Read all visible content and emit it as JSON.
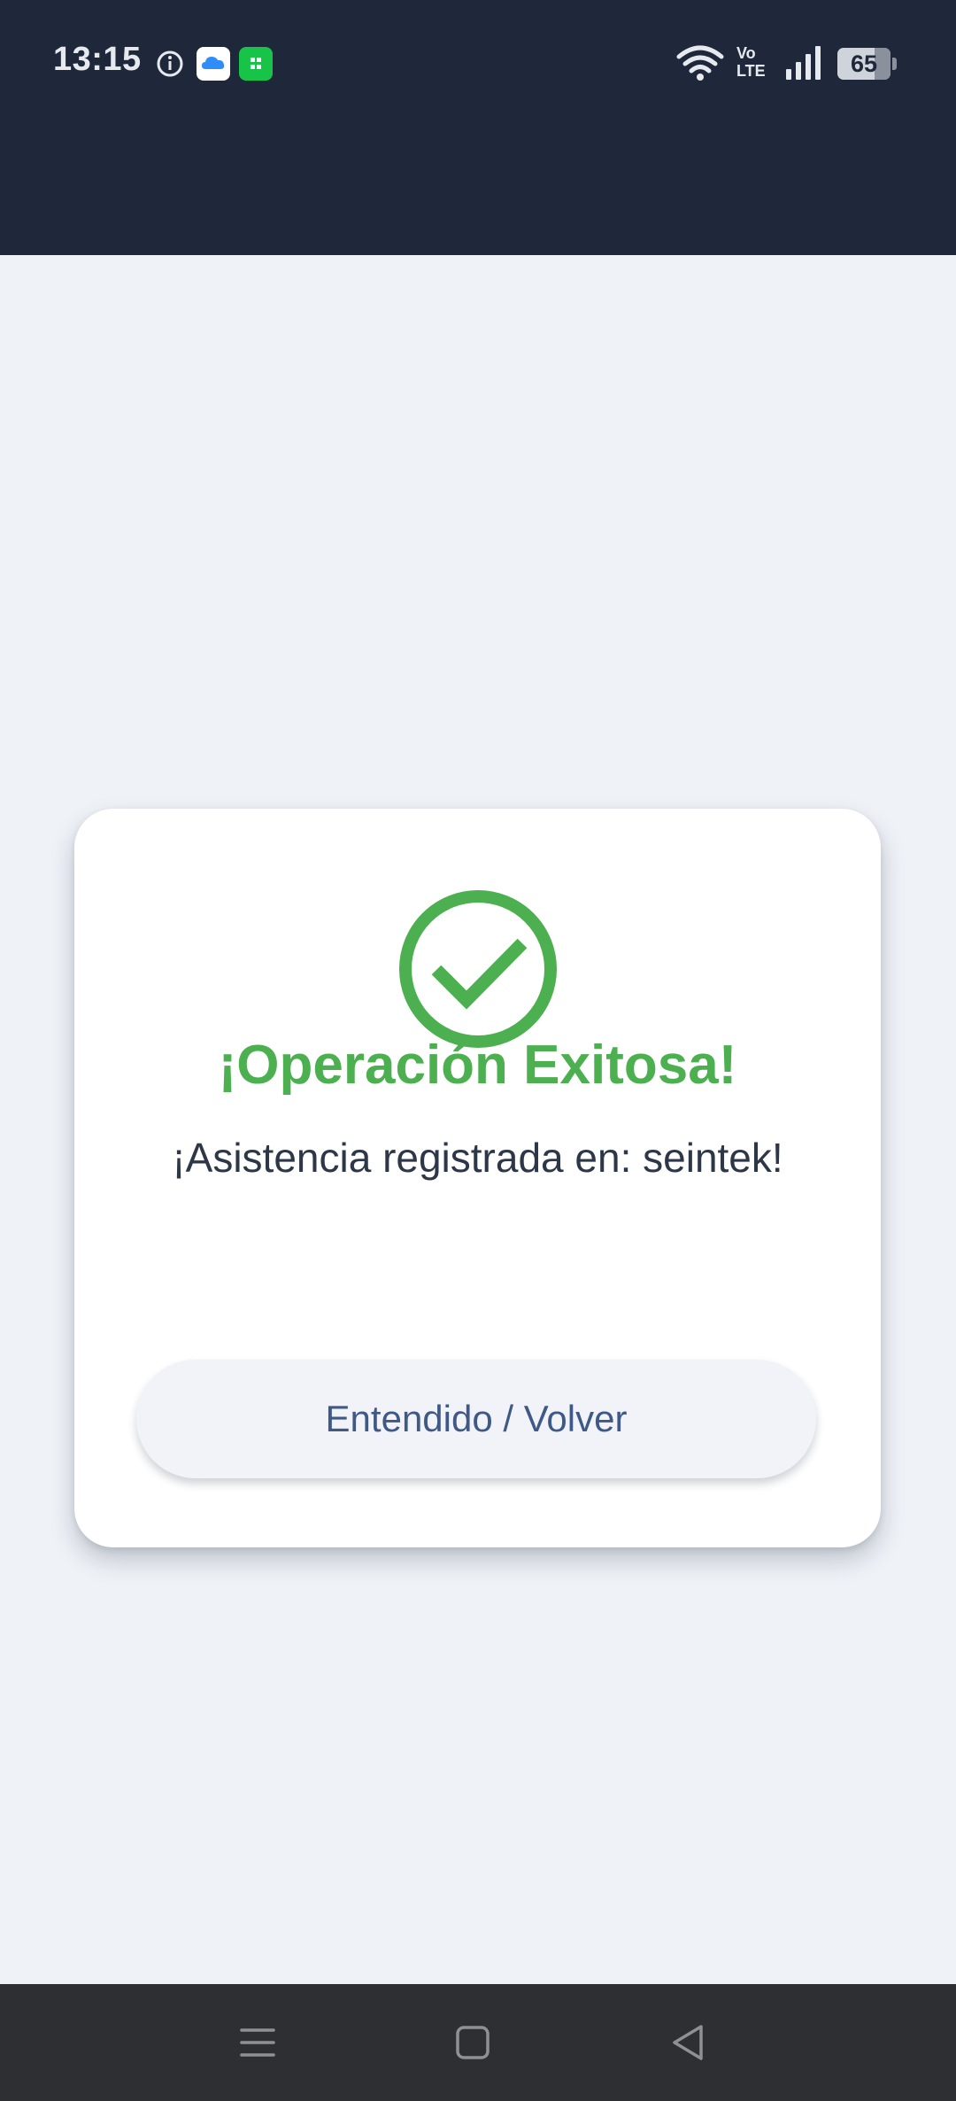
{
  "status_bar": {
    "time": "13:15",
    "battery_level": "65",
    "volte_top": "Vo",
    "volte_bottom": "LTE",
    "icons": [
      "info-icon",
      "cloud-app-icon",
      "green-app-icon",
      "wifi-icon",
      "volte-icon",
      "signal-icon",
      "battery-icon"
    ]
  },
  "dialog": {
    "icon": "check-circle-icon",
    "title": "¡Operación Exitosa!",
    "message": "¡Asistencia registrada en: seintek!",
    "button_label": "Entendido / Volver"
  },
  "nav_bar": {
    "icons": [
      "menu-icon",
      "home-icon",
      "back-icon"
    ]
  },
  "colors": {
    "header": "#1f283a",
    "background": "#eff2f7",
    "success": "#4caf50",
    "button_text": "#3f5987",
    "nav_bar": "#2e2f33"
  }
}
